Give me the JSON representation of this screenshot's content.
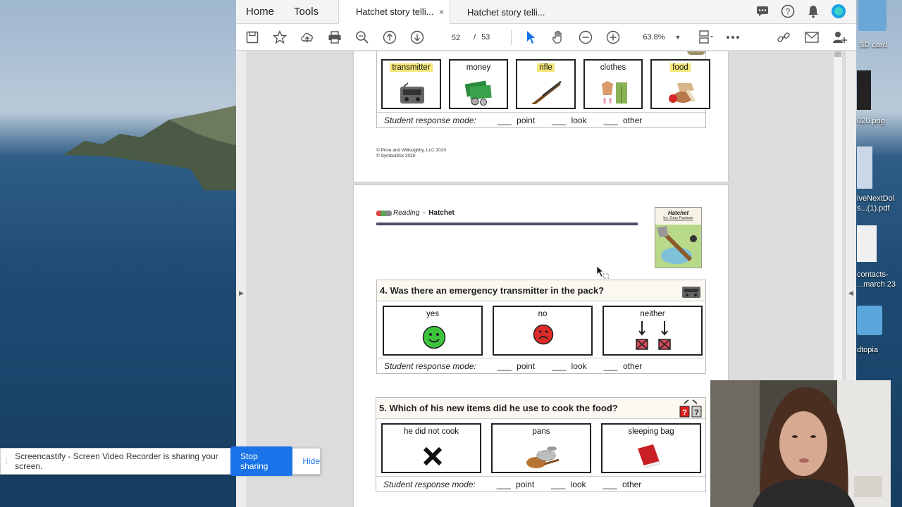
{
  "menubar": {
    "home": "Home",
    "tools": "Tools",
    "tabs": [
      {
        "label": "Hatchet story telli..."
      },
      {
        "label": "Hatchet story telli..."
      }
    ],
    "close_glyph": "×"
  },
  "toolbar": {
    "page_current": "52",
    "page_sep": "/",
    "page_total": "53",
    "zoom": "63.8%"
  },
  "desktop": {
    "items": [
      {
        "label": "SD card"
      },
      {
        "label": "020.png"
      },
      {
        "label": "iveNextDol\ns...(1).pdf"
      },
      {
        "label": "contacts-\n...march 23"
      },
      {
        "label": "dtopia"
      }
    ]
  },
  "page1": {
    "choices": [
      {
        "label": "transmitter",
        "highlight": true,
        "icon": "radio-icon"
      },
      {
        "label": "money",
        "highlight": false,
        "icon": "money-icon"
      },
      {
        "label": "rifle",
        "highlight": true,
        "icon": "rifle-icon"
      },
      {
        "label": "clothes",
        "highlight": false,
        "icon": "clothes-icon"
      },
      {
        "label": "food",
        "highlight": true,
        "icon": "food-icon"
      }
    ],
    "response": {
      "label": "Student response mode:",
      "blank": "___",
      "point": "point",
      "look": "look",
      "other": "other"
    },
    "copyright1": "© Price and Willoughby, LLC 2020",
    "copyright2": "© SymbolStix 2020"
  },
  "page2": {
    "header_reading": "Reading",
    "header_sep": " - ",
    "header_title": "Hatchet",
    "book_title": "Hatchet",
    "book_author": "by: Gary Paulsen",
    "q4": {
      "text": "4. Was there an emergency transmitter in the pack?",
      "choices": [
        {
          "label": "yes",
          "icon": "smiley-green-icon"
        },
        {
          "label": "no",
          "icon": "frown-red-icon"
        },
        {
          "label": "neither",
          "icon": "neither-icon"
        }
      ]
    },
    "q5": {
      "text": "5. Which of his new items did he use to cook the food?",
      "choices": [
        {
          "label": "he did not cook",
          "icon": "x-mark-icon"
        },
        {
          "label": "pans",
          "icon": "pans-icon"
        },
        {
          "label": "sleeping bag",
          "icon": "sleeping-bag-icon"
        }
      ]
    },
    "response": {
      "label": "Student response mode:",
      "blank": "___",
      "point": "point",
      "look": "look",
      "other": "other"
    }
  },
  "notification": {
    "message": "Screencastify - Screen Video Recorder is sharing your screen.",
    "stop": "Stop sharing",
    "hide": "Hide"
  },
  "colors": {
    "accent": "#1a73e8",
    "highlight": "#f5e77b",
    "header_rule": "#4a5069"
  }
}
